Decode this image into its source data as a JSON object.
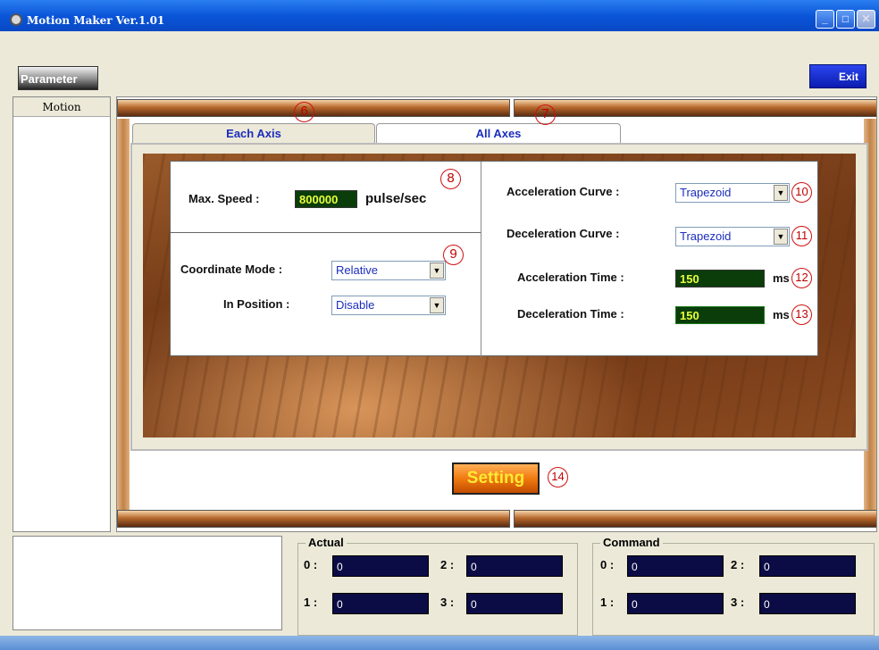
{
  "window": {
    "title": "Motion Maker Ver.1.01"
  },
  "toolbar": {
    "parameter_label": "Parameter",
    "exit_label": "Exit"
  },
  "sidebar": {
    "header": "Motion"
  },
  "tabs": [
    {
      "label": "Each Axis"
    },
    {
      "label": "All Axes"
    }
  ],
  "settings": {
    "max_speed_label": "Max. Speed :",
    "max_speed_value": "800000",
    "max_speed_unit": "pulse/sec",
    "coordinate_mode_label": "Coordinate Mode :",
    "coordinate_mode_value": "Relative",
    "in_position_label": "In Position :",
    "in_position_value": "Disable",
    "accel_curve_label": "Acceleration Curve :",
    "accel_curve_value": "Trapezoid",
    "decel_curve_label": "Deceleration Curve :",
    "decel_curve_value": "Trapezoid",
    "accel_time_label": "Acceleration Time :",
    "accel_time_value": "150",
    "accel_time_unit": "ms",
    "decel_time_label": "Deceleration Time :",
    "decel_time_value": "150",
    "decel_time_unit": "ms"
  },
  "setting_button_label": "Setting",
  "callouts": [
    "6",
    "7",
    "8",
    "9",
    "10",
    "11",
    "12",
    "13",
    "14"
  ],
  "positions": {
    "actual_title": "Actual",
    "command_title": "Command",
    "axis_labels": [
      "0 :",
      "1 :",
      "2 :",
      "3 :"
    ],
    "actual": [
      "0",
      "0",
      "0",
      "0"
    ],
    "command": [
      "0",
      "0",
      "0",
      "0"
    ]
  },
  "colors": {
    "title_bar": "#0a54d8",
    "tab_text": "#1b2dbd",
    "field_bg": "#0b3d0b",
    "field_text": "#e8ff3a",
    "callout": "#d01010",
    "setting_button": "#f07a10"
  }
}
